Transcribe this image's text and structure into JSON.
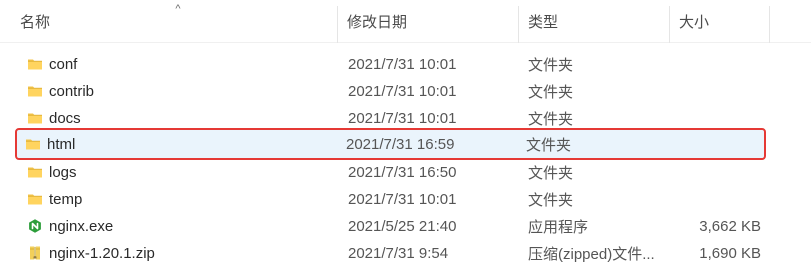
{
  "header": {
    "columns": {
      "name": "名称",
      "date_modified": "修改日期",
      "type": "类型",
      "size": "大小"
    },
    "sort_indicator": "^"
  },
  "rows": [
    {
      "name": "conf",
      "date": "2021/7/31 10:01",
      "type": "文件夹",
      "size": "",
      "icon": "folder-icon"
    },
    {
      "name": "contrib",
      "date": "2021/7/31 10:01",
      "type": "文件夹",
      "size": "",
      "icon": "folder-icon"
    },
    {
      "name": "docs",
      "date": "2021/7/31 10:01",
      "type": "文件夹",
      "size": "",
      "icon": "folder-icon"
    },
    {
      "name": "html",
      "date": "2021/7/31 16:59",
      "type": "文件夹",
      "size": "",
      "icon": "folder-icon",
      "highlighted": true
    },
    {
      "name": "logs",
      "date": "2021/7/31 16:50",
      "type": "文件夹",
      "size": "",
      "icon": "folder-icon"
    },
    {
      "name": "temp",
      "date": "2021/7/31 10:01",
      "type": "文件夹",
      "size": "",
      "icon": "folder-icon"
    },
    {
      "name": "nginx.exe",
      "date": "2021/5/25 21:40",
      "type": "应用程序",
      "size": "3,662 KB",
      "icon": "nginx-app-icon"
    },
    {
      "name": "nginx-1.20.1.zip",
      "date": "2021/7/31 9:54",
      "type": "压缩(zipped)文件...",
      "size": "1,690 KB",
      "icon": "zip-icon"
    }
  ],
  "colors": {
    "highlight_border": "#e53935",
    "highlight_fill": "#eaf4fc",
    "folder": "#f4c64d",
    "nginx_green": "#2c9d3a"
  }
}
